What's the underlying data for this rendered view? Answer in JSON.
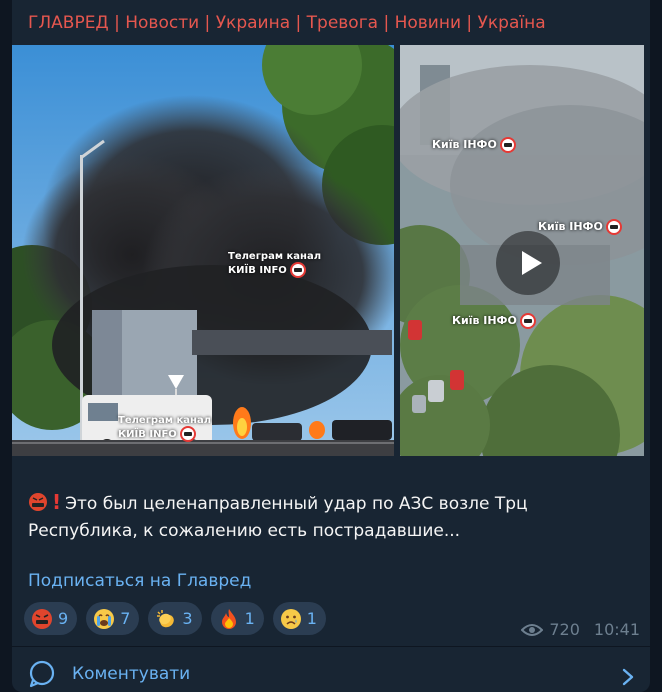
{
  "channel": {
    "title": "ГЛАВРЕД | Новости | Украина | Тревога | Новини | Україна"
  },
  "media": {
    "left_watermark_top_line1": "Телеграм канал",
    "left_watermark_top_line2": "КИЇВ INFO",
    "left_watermark_bottom_line1": "Телеграм канал",
    "left_watermark_bottom_line2": "КИЇВ INFO",
    "right_watermark_1": "Київ ІНФО",
    "right_watermark_2": "Київ ІНФО",
    "right_watermark_3": "Київ ІНФО",
    "play_icon": "play-icon"
  },
  "post": {
    "text": "Это был целенаправленный удар по АЗС возле Трц Республика, к сожалению есть пострадавшие...",
    "subscribe_link": "Подписаться на Главред"
  },
  "reactions": [
    {
      "icon": "angry-face-icon",
      "count": "9"
    },
    {
      "icon": "crying-face-icon",
      "count": "7"
    },
    {
      "icon": "clapping-hands-icon",
      "count": "3"
    },
    {
      "icon": "fire-icon",
      "count": "1"
    },
    {
      "icon": "sad-face-icon",
      "count": "1"
    }
  ],
  "meta": {
    "views": "720",
    "time": "10:41",
    "views_icon": "eye-icon"
  },
  "comments": {
    "label": "Коментувати",
    "icon": "comment-bubble-icon",
    "chevron_icon": "chevron-right-icon"
  },
  "colors": {
    "background": "#0e1621",
    "bubble": "#182533",
    "header_red": "#e5574f",
    "link_blue": "#6ab2f2",
    "reaction_bg": "#2b3d52",
    "meta_gray": "#6d7f8f"
  }
}
